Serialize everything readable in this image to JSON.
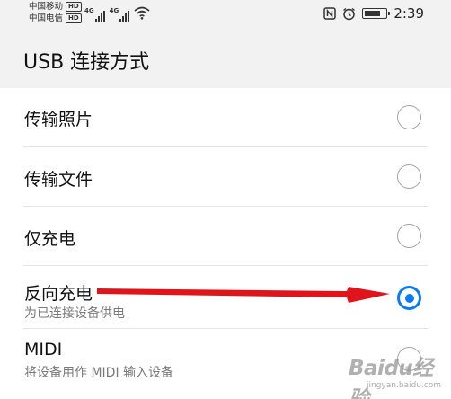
{
  "status_bar": {
    "carrier_1": "中国移动",
    "carrier_2": "中国电信",
    "hd_badge": "HD",
    "network_label": "4G",
    "time": "2:39",
    "icons": [
      "nfc-icon",
      "alarm-icon",
      "battery-icon",
      "wifi-icon",
      "signal-icon"
    ],
    "battery_level": 0.8
  },
  "header": {
    "title": "USB 连接方式"
  },
  "options": [
    {
      "label": "传输照片",
      "selected": false
    },
    {
      "label": "传输文件",
      "selected": false
    },
    {
      "label": "仅充电",
      "selected": false
    },
    {
      "label": "反向充电",
      "subtitle": "为已连接设备供电",
      "selected": true
    },
    {
      "label": "MIDI",
      "subtitle": "将设备用作 MIDI 输入设备",
      "selected": false
    }
  ],
  "annotation": {
    "arrow_color": "#e0141b"
  },
  "watermark": {
    "text": "Baidu经验",
    "url": "jingyan.baidu.com"
  },
  "colors": {
    "accent": "#0a7bf3",
    "background": "#f2f2f2",
    "list_background": "#ffffff"
  }
}
